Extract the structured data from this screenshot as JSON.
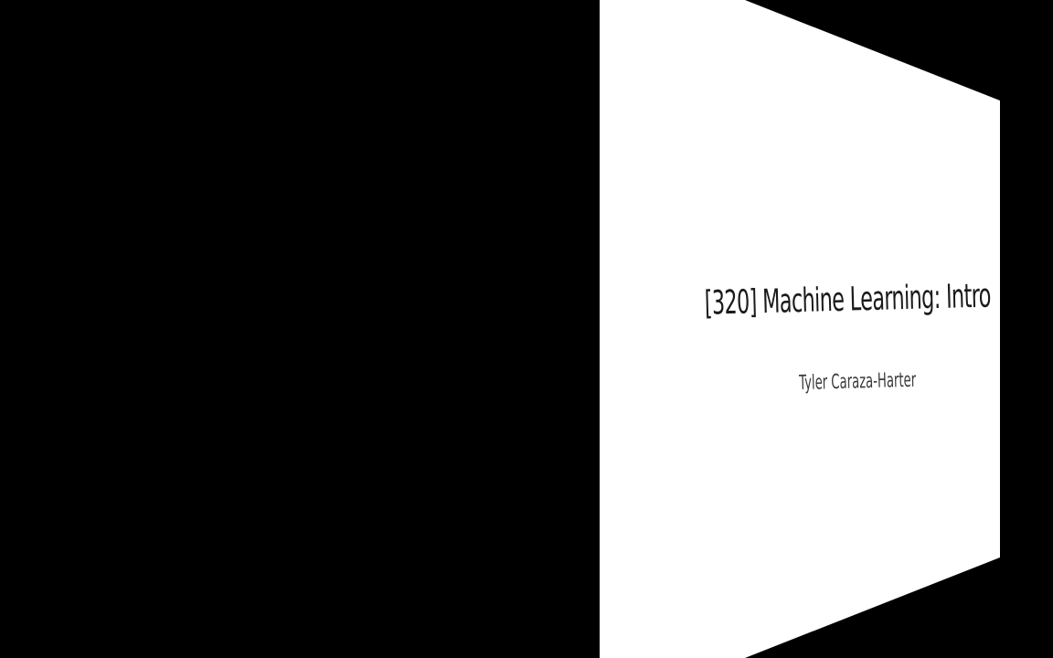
{
  "slide": {
    "title": "[320] Machine Learning: Intro",
    "subtitle": "Tyler Caraza-Harter"
  },
  "colors": {
    "background": "#000000",
    "slide": "#ffffff",
    "title_text": "#1a1a1a",
    "subtitle_text": "#3a3a3a"
  }
}
